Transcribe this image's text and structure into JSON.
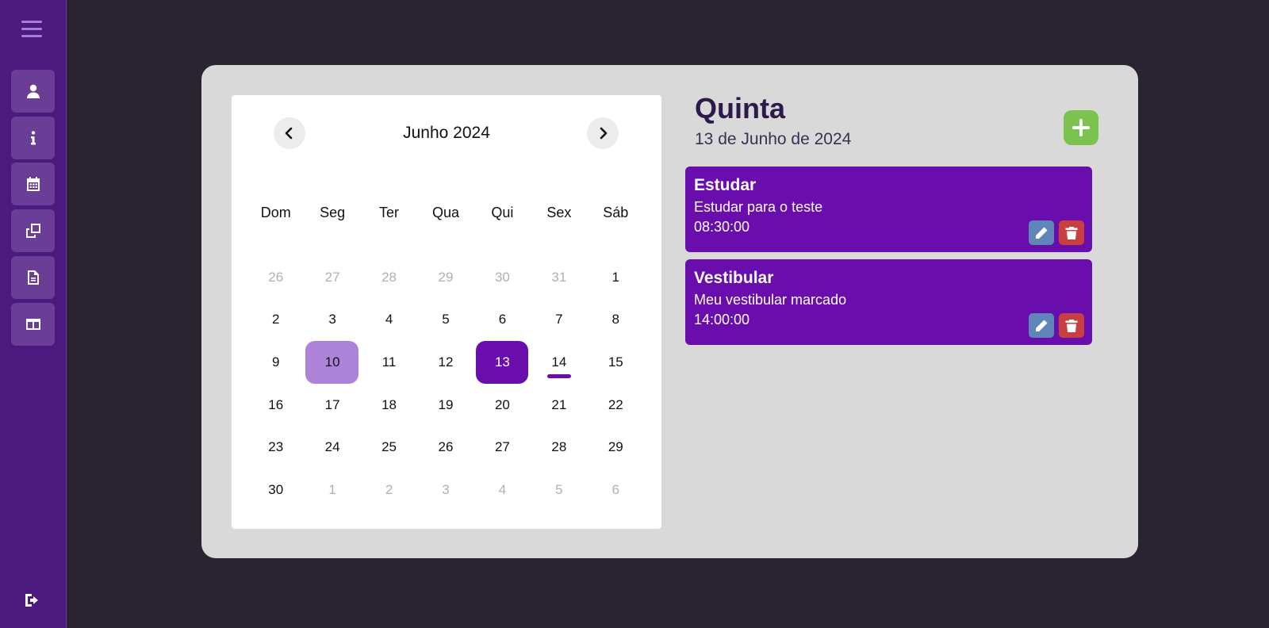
{
  "sidebar": {
    "items": [
      {
        "icon": "user-icon",
        "label": ""
      },
      {
        "icon": "info-icon",
        "label": ""
      },
      {
        "icon": "calendar-icon",
        "label": ""
      },
      {
        "icon": "copy-icon",
        "label": ""
      },
      {
        "icon": "document-icon",
        "label": ""
      },
      {
        "icon": "columns-icon",
        "label": ""
      }
    ],
    "logout_icon": "logout-icon",
    "menu_icon": "hamburger-icon"
  },
  "calendar": {
    "title": "Junho 2024",
    "weekdays": [
      "Dom",
      "Seg",
      "Ter",
      "Qua",
      "Qui",
      "Sex",
      "Sáb"
    ],
    "days": [
      {
        "n": "26",
        "other": true
      },
      {
        "n": "27",
        "other": true
      },
      {
        "n": "28",
        "other": true
      },
      {
        "n": "29",
        "other": true
      },
      {
        "n": "30",
        "other": true
      },
      {
        "n": "31",
        "other": true
      },
      {
        "n": "1"
      },
      {
        "n": "2"
      },
      {
        "n": "3"
      },
      {
        "n": "4"
      },
      {
        "n": "5"
      },
      {
        "n": "6"
      },
      {
        "n": "7"
      },
      {
        "n": "8"
      },
      {
        "n": "9"
      },
      {
        "n": "10",
        "state": "highlight"
      },
      {
        "n": "11"
      },
      {
        "n": "12"
      },
      {
        "n": "13",
        "state": "selected"
      },
      {
        "n": "14",
        "state": "today"
      },
      {
        "n": "15"
      },
      {
        "n": "16"
      },
      {
        "n": "17"
      },
      {
        "n": "18"
      },
      {
        "n": "19"
      },
      {
        "n": "20"
      },
      {
        "n": "21"
      },
      {
        "n": "22"
      },
      {
        "n": "23"
      },
      {
        "n": "24"
      },
      {
        "n": "25"
      },
      {
        "n": "26"
      },
      {
        "n": "27"
      },
      {
        "n": "28"
      },
      {
        "n": "29"
      },
      {
        "n": "30"
      },
      {
        "n": "1",
        "other": true
      },
      {
        "n": "2",
        "other": true
      },
      {
        "n": "3",
        "other": true
      },
      {
        "n": "4",
        "other": true
      },
      {
        "n": "5",
        "other": true
      },
      {
        "n": "6",
        "other": true
      }
    ]
  },
  "agenda": {
    "weekday": "Quinta",
    "date": "13 de Junho de 2024",
    "events": [
      {
        "title": "Estudar",
        "description": "Estudar para o teste",
        "time": "08:30:00"
      },
      {
        "title": "Vestibular",
        "description": "Meu vestibular marcado",
        "time": "14:00:00"
      }
    ]
  },
  "colors": {
    "sidebar": "#4c1a7e",
    "accent": "#6a0dad",
    "highlight": "#ad83da",
    "add": "#7cc24e",
    "edit": "#5e86b8",
    "delete": "#c73f3f"
  }
}
